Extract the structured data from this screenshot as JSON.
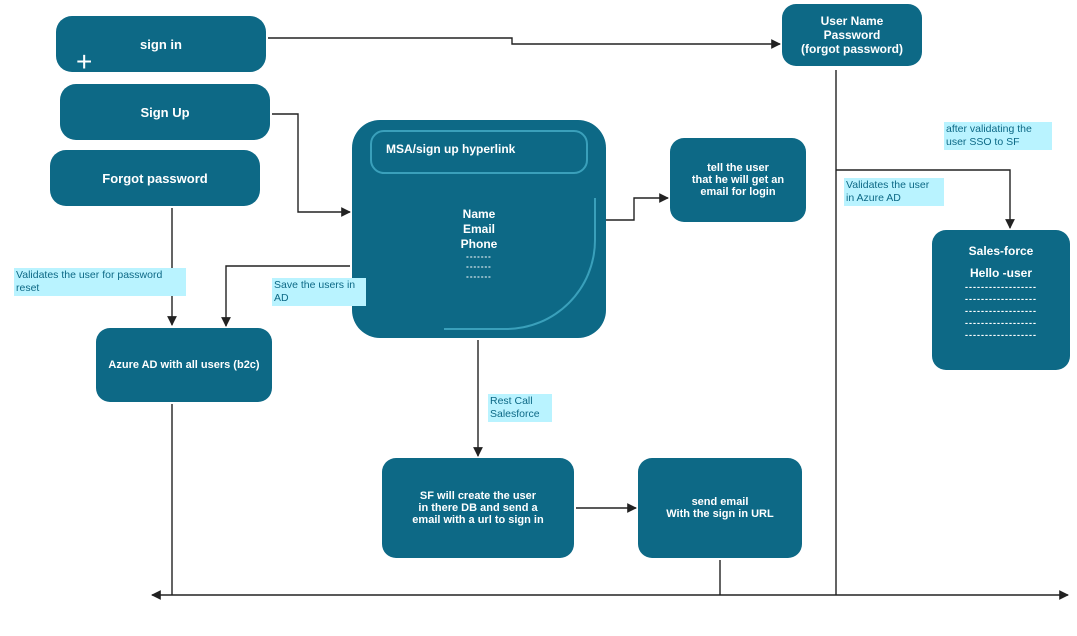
{
  "colors": {
    "node": "#0d6986",
    "labelBg": "#b9f3ff"
  },
  "stack": {
    "signIn": "sign in",
    "signUp": "Sign Up",
    "forgot": "Forgot password"
  },
  "userName": {
    "l1": "User Name",
    "l2": "Password",
    "l3": "(forgot password)"
  },
  "msa": {
    "header": "MSA/sign up hyperlink",
    "f1": "Name",
    "f2": "Email",
    "f3": "Phone",
    "d": "-------"
  },
  "tellUser": {
    "l1": "tell the user",
    "l2": "that he will get an",
    "l3": "email for login"
  },
  "azure": "Azure AD with all users (b2c)",
  "sfCreate": {
    "l1": "SF will create the user",
    "l2": "in there DB and send a",
    "l3": "email with a url to sign in"
  },
  "sendEmail": {
    "l1": "send email",
    "l2": "With the sign in URL"
  },
  "salesforce": {
    "l1": "Sales-force",
    "l2": "Hello -user",
    "d": "------------------"
  },
  "labels": {
    "validateReset": "Validates the user for password\nreset",
    "saveAD": "Save the users in\nAD",
    "restCall": "Rest Call\nSalesforce",
    "validateAzure": "Validates the user\nin Azure AD",
    "afterSSO": "after validating the\nuser  SSO to SF"
  }
}
